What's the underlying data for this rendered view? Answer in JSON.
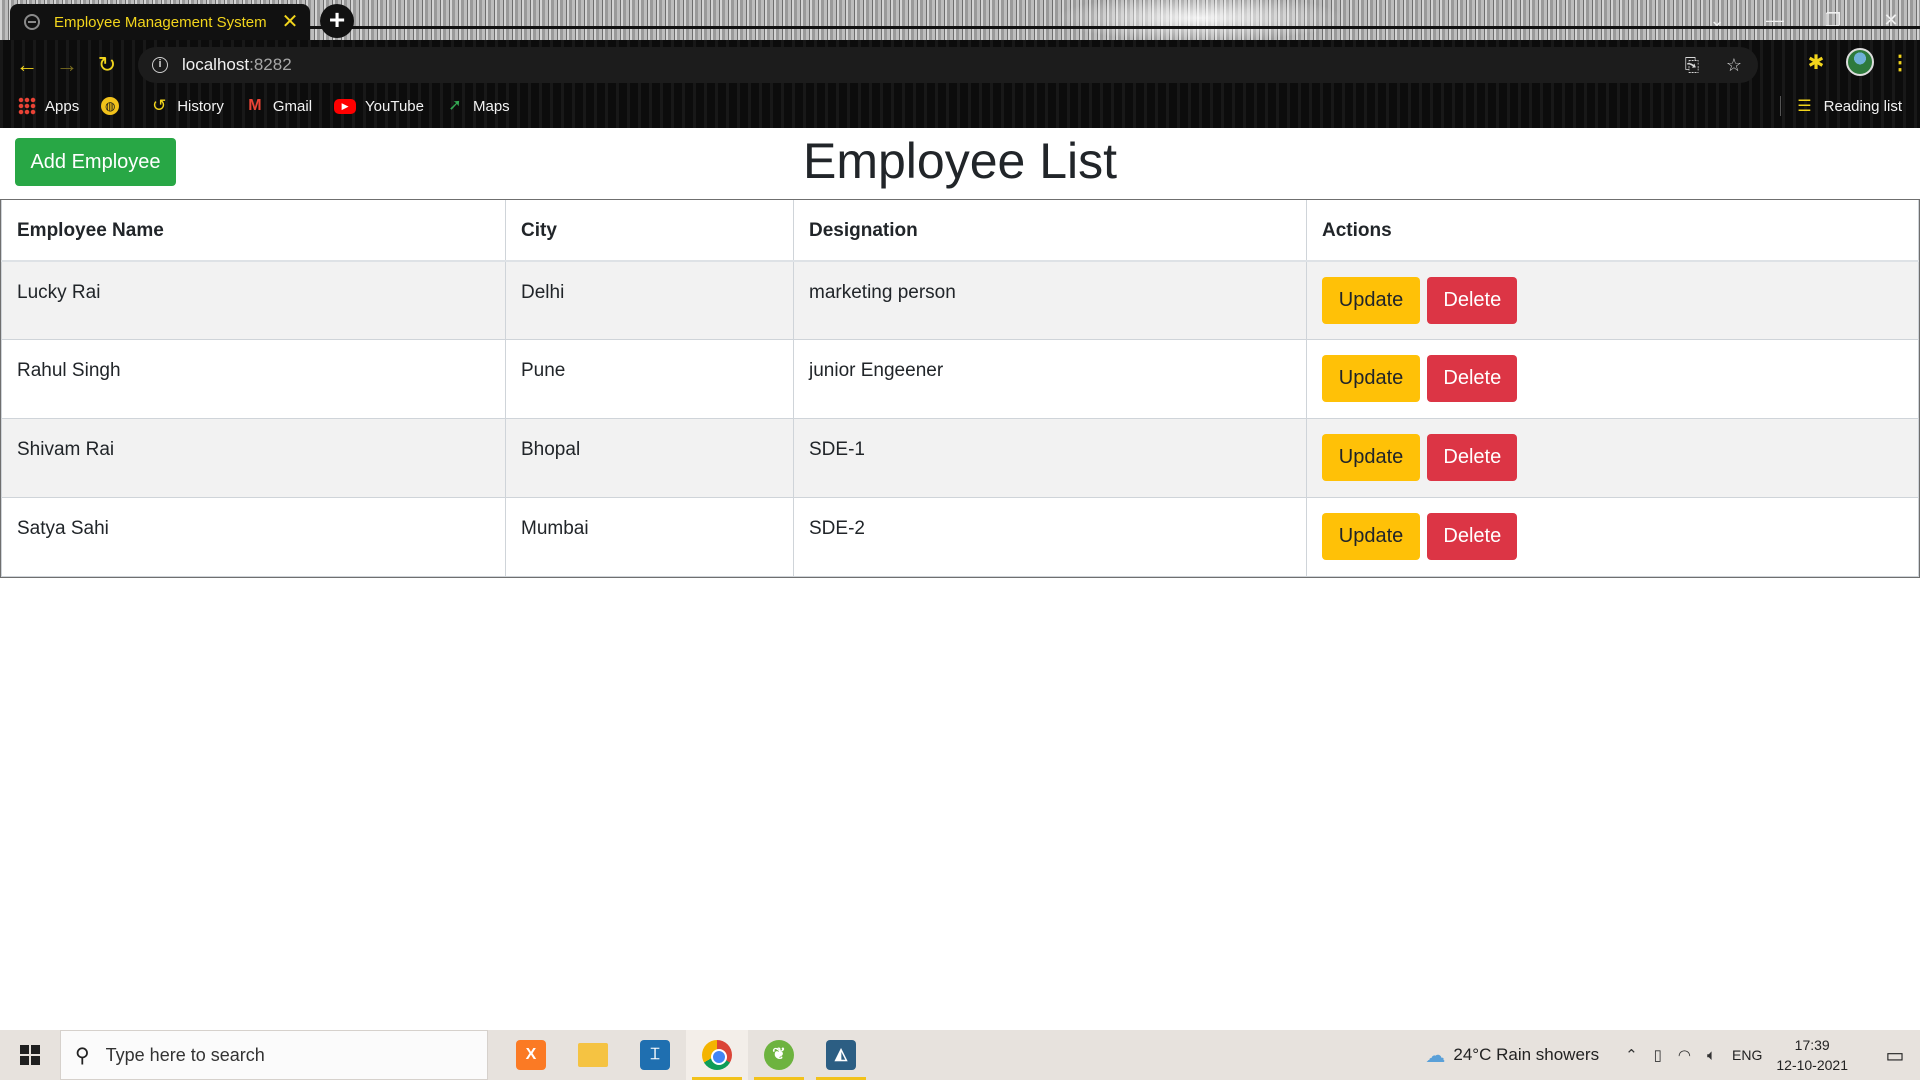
{
  "browser": {
    "tab_title": "Employee Management System",
    "tab_close": "✕",
    "new_tab": "+",
    "url_host": "localhost",
    "url_port": ":8282",
    "bookmarks": [
      {
        "label": "Apps",
        "icon": "apps-icon"
      },
      {
        "label": "",
        "icon": "globe-icon"
      },
      {
        "label": "History",
        "icon": "history-icon"
      },
      {
        "label": "Gmail",
        "icon": "gmail-icon"
      },
      {
        "label": "YouTube",
        "icon": "youtube-icon"
      },
      {
        "label": "Maps",
        "icon": "maps-icon"
      }
    ],
    "reading_list": "Reading list"
  },
  "page": {
    "add_button": "Add Employee",
    "title": "Employee List",
    "columns": [
      "Employee Name",
      "City",
      "Designation",
      "Actions"
    ],
    "employees": [
      {
        "name": "Lucky Rai",
        "city": "Delhi",
        "designation": "marketing person"
      },
      {
        "name": "Rahul Singh",
        "city": "Pune",
        "designation": "junior Engeener"
      },
      {
        "name": "Shivam Rai",
        "city": "Bhopal",
        "designation": "SDE-1"
      },
      {
        "name": "Satya Sahi",
        "city": "Mumbai",
        "designation": "SDE-2"
      }
    ],
    "update_label": "Update",
    "delete_label": "Delete"
  },
  "taskbar": {
    "search_placeholder": "Type here to search",
    "weather": "24°C  Rain showers",
    "language": "ENG",
    "time": "17:39",
    "date": "12-10-2021"
  },
  "colors": {
    "add_button": "#28a745",
    "update_button": "#ffc107",
    "delete_button": "#dc3545",
    "tab_accent": "#f2d51c"
  }
}
